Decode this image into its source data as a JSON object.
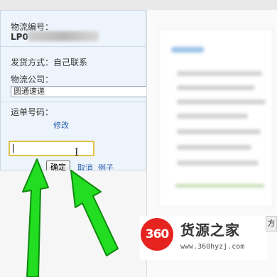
{
  "form": {
    "tracking_label": "物流编号：",
    "tracking_prefix": "LP0",
    "ship_method": "发货方式：自己联系",
    "company_label": "物流公司：",
    "company_value": "圆通速递",
    "waybill_label": "运单号码：",
    "modify_link": "修改",
    "waybill_input_value": "",
    "confirm_button": "确定",
    "cancel_link": "取消",
    "example_link": "例子"
  },
  "watermark": {
    "logo_text": "360",
    "name": "货源之家",
    "url": "www.360hyzj.com"
  },
  "side_tab": {
    "label": "方"
  },
  "colors": {
    "arrow": "#22dd22",
    "link": "#2a62b0",
    "panel_bg": "#eef4fb",
    "logo_red": "#e52420"
  },
  "icons": [
    "text-cursor-icon",
    "arrow-up-icon"
  ]
}
